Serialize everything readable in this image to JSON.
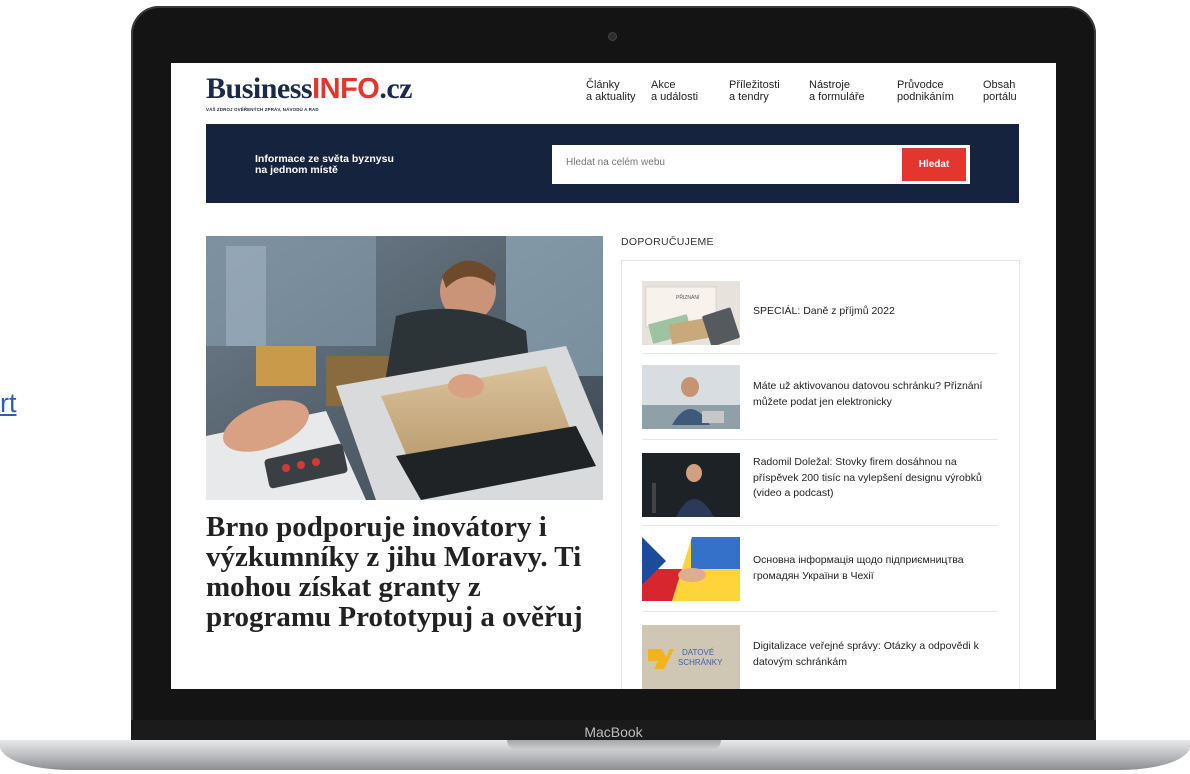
{
  "side_link": "rt",
  "device": {
    "label": "MacBook"
  },
  "site": {
    "logo_main": "Business",
    "logo_accent": "INFO",
    "logo_tld": ".cz",
    "tagline": "VÁŠ ZDROJ OVĚŘENÝCH ZPRÁV, NÁVODŮ A RAD"
  },
  "nav": [
    {
      "line1": "Články",
      "line2": "a aktuality"
    },
    {
      "line1": "Akce",
      "line2": "a události"
    },
    {
      "line1": "Příležitosti",
      "line2": "a tendry"
    },
    {
      "line1": "Nástroje",
      "line2": "a formuláře"
    },
    {
      "line1": "Průvodce",
      "line2": "podnikáním"
    },
    {
      "line1": "Obsah",
      "line2": "portálu"
    }
  ],
  "banner": {
    "line1": "Informace ze světa byznysu",
    "line2": "na jednom místě"
  },
  "search": {
    "placeholder": "Hledat na celém webu",
    "button": "Hledat"
  },
  "hero": {
    "headline": "Brno podporuje inovátory i výzkumníky z jihu Moravy. Ti mohou získat granty z programu Prototypuj a ověřuj"
  },
  "recommended": {
    "title": "DOPORUČUJEME",
    "items": [
      {
        "text": "SPECIÁL: Daně z příjmů 2022",
        "thumb_text": "PŘIZNÁNÍ"
      },
      {
        "text": "Máte už aktivovanou datovou schránku? Přiznání můžete podat jen elektronicky"
      },
      {
        "text": "Radomil Doležal: Stovky firem dosáhnou na příspěvek 200 tisíc na vylepšení designu výrobků (video a podcast)"
      },
      {
        "text": "Основна інформація щодо підприємництва громадян України в Чехії"
      },
      {
        "text": "Digitalizace veřejné správy: Otázky a odpovědi k datovým schránkám",
        "thumb_text_1": "DATOVÉ",
        "thumb_text_2": "SCHRÁNKY"
      }
    ]
  },
  "colors": {
    "navy": "#16233f",
    "accent_red": "#e2362f"
  }
}
